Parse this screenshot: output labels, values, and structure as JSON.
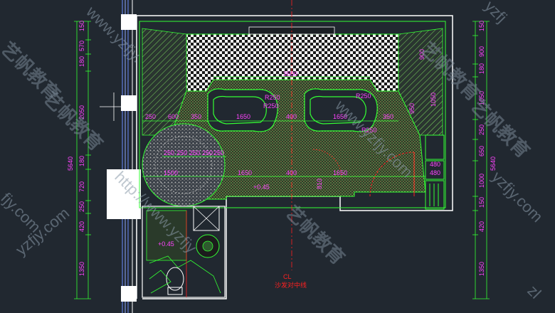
{
  "plan": {
    "room_width_label": "3500",
    "ceiling_level": "+0.45",
    "bath_level": "+0.45",
    "centerline_label": "CL",
    "centerline_caption": "沙发对中线"
  },
  "dims_top_row": [
    "250",
    "600",
    "350",
    "1650",
    "400",
    "1650",
    "350"
  ],
  "dims_mid_row": [
    "250",
    "250",
    "250",
    "250",
    "250"
  ],
  "dims_lower_row": [
    "1500",
    "1650",
    "400",
    "1650",
    "480"
  ],
  "dims_left_chain": [
    "150",
    "570",
    "180",
    "2050",
    "180",
    "720",
    "250",
    "420",
    "1350"
  ],
  "dim_left_total": "5640",
  "dims_right_chain": [
    "150",
    "900",
    "180",
    "1050",
    "250",
    "650",
    "1000",
    "150",
    "420",
    "1350"
  ],
  "dim_right_total": "5640",
  "dims_misc": [
    "R250",
    "R250",
    "R250",
    "R250",
    "810",
    "480",
    "950"
  ],
  "watermarks": {
    "url_fragments": [
      "www.yzfjy.",
      "yzfjy.com",
      "http://www.yzfjy",
      "www.yzfjy.com",
      "fjy.com",
      "yzfj",
      "zl"
    ],
    "brand": "艺帆教育"
  },
  "colors": {
    "background": "#212830",
    "wall_green": "#33ff33",
    "dimension_magenta": "#ff44ff",
    "wall_white": "#ffffff",
    "hatch_yellow": "#e8e84a",
    "axis_red": "#ff2020"
  }
}
